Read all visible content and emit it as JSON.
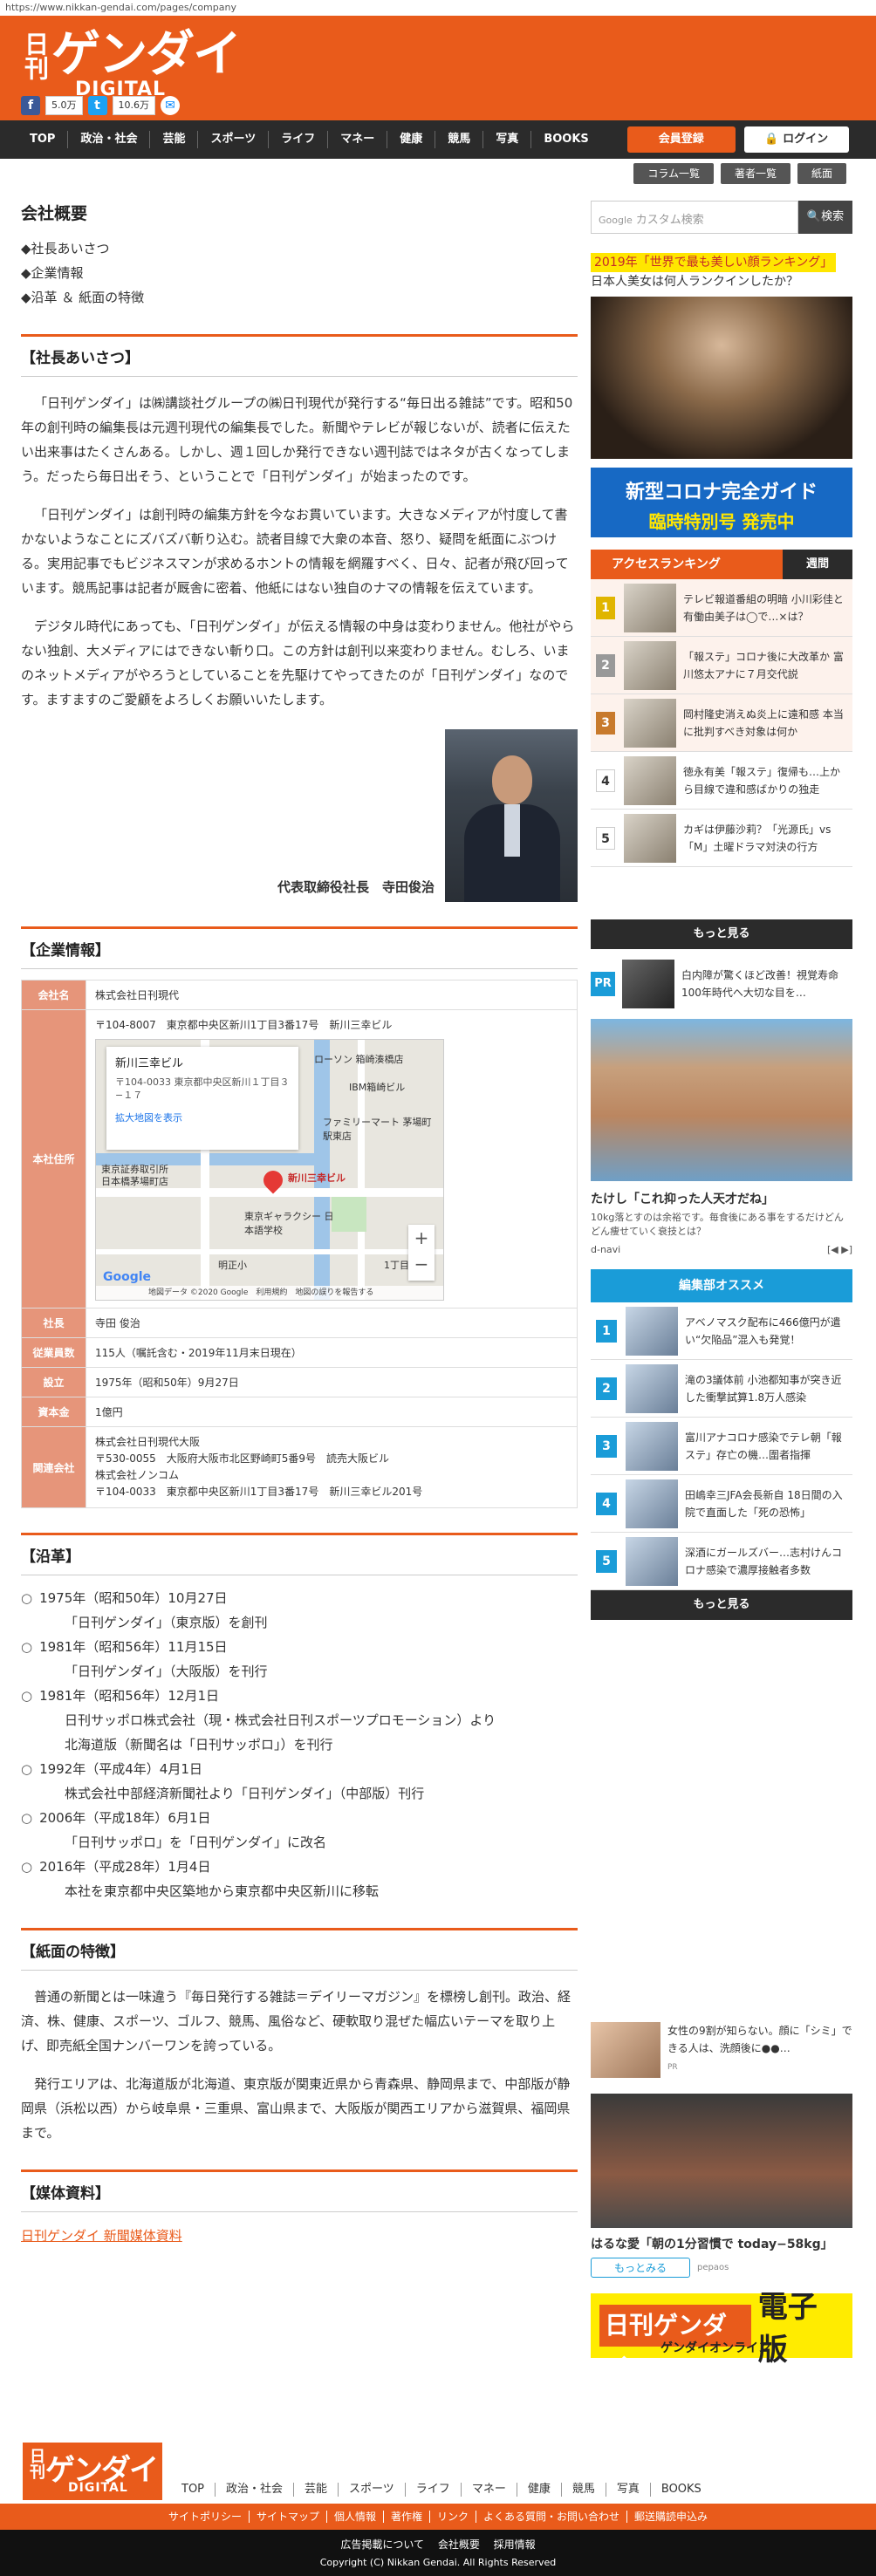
{
  "browser": {
    "url": "https://www.nikkan-gendai.com/pages/company"
  },
  "header": {
    "logo_nikkan": "日刊",
    "logo_gendai": "ゲンダイ",
    "logo_digital": "DIGITAL",
    "fb_count": "5.0万",
    "tw_count": "10.6万"
  },
  "nav": {
    "items": [
      "TOP",
      "政治・社会",
      "芸能",
      "スポーツ",
      "ライフ",
      "マネー",
      "健康",
      "競馬",
      "写真",
      "BOOKS"
    ],
    "member": "会員登録",
    "login": "ログイン"
  },
  "subnav": [
    "コラム一覧",
    "著者一覧",
    "紙面"
  ],
  "page": {
    "title": "会社概要",
    "toc": [
      "◆社長あいさつ",
      "◆企業情報",
      "◆沿革 ＆ 紙面の特徴"
    ]
  },
  "greeting": {
    "heading": "【社長あいさつ】",
    "paragraphs": [
      "「日刊ゲンダイ」は㈱講談社グループの㈱日刊現代が発行する“毎日出る雑誌”です。昭和50年の創刊時の編集長は元週刊現代の編集長でした。新聞やテレビが報じないが、読者に伝えたい出来事はたくさんある。しかし、週１回しか発行できない週刊誌ではネタが古くなってしまう。だったら毎日出そう、ということで「日刊ゲンダイ」が始まったのです。",
      "「日刊ゲンダイ」は創刊時の編集方針を今なお貫いています。大きなメディアが忖度して書かないようなことにズバズバ斬り込む。読者目線で大衆の本音、怒り、疑問を紙面にぶつける。実用記事でもビジネスマンが求めるホントの情報を網羅すべく、日々、記者が飛び回っています。競馬記事は記者が厩舎に密着、他紙にはない独自のナマの情報を伝えています。",
      "デジタル時代にあっても、「日刊ゲンダイ」が伝える情報の中身は変わりません。他社がやらない独創、大メディアにはできない斬り口。この方針は創刊以来変わりません。むしろ、いまのネットメディアがやろうとしていることを先駆けてやってきたのが「日刊ゲンダイ」なのです。ますますのご愛顧をよろしくお願いいたします。"
    ],
    "signature": "代表取締役社長　寺田俊治"
  },
  "company": {
    "heading": "【企業情報】",
    "rows": {
      "name_k": "会社名",
      "name_v": "株式会社日刊現代",
      "addr_k": "本社住所",
      "addr_v": "〒104-8007　東京都中央区新川1丁目3番17号　新川三幸ビル",
      "ceo_k": "社長",
      "ceo_v": "寺田 俊治",
      "emp_k": "従業員数",
      "emp_v": "115人（嘱託含む・2019年11月末日現在）",
      "est_k": "設立",
      "est_v": "1975年（昭和50年）9月27日",
      "cap_k": "資本金",
      "cap_v": "1億円",
      "rel_k": "関連会社",
      "rel_v": [
        "株式会社日刊現代大阪",
        "〒530-0055　大阪府大阪市北区野崎町5番9号　読売大阪ビル",
        "株式会社ノンコム",
        "〒104-0033　東京都中央区新川1丁目3番17号　新川三幸ビル201号"
      ]
    },
    "map": {
      "card_title": "新川三幸ビル",
      "card_addr": "〒104-0033 東京都中央区新川１丁目３−１７",
      "card_link": "拡大地図を表示",
      "labels": [
        "ローソン 箱崎湊橋店",
        "IBM箱崎ビル",
        "ファミリーマート 茅場町駅東店",
        "新川三幸ビル",
        "東京証券取引所",
        "日本橋茅場町店",
        "東京ギャラクシー 日本語学校",
        "明正小",
        "1丁目"
      ],
      "google": "Google",
      "footer": "地図データ ©2020 Google　利用規約　地図の誤りを報告する",
      "zoom_in": "+",
      "zoom_out": "−"
    }
  },
  "history": {
    "heading": "【沿革】",
    "items": [
      {
        "date": "1975年（昭和50年）10月27日",
        "lines": [
          "「日刊ゲンダイ」（東京版）を創刊"
        ]
      },
      {
        "date": "1981年（昭和56年）11月15日",
        "lines": [
          "「日刊ゲンダイ」（大阪版）を刊行"
        ]
      },
      {
        "date": "1981年（昭和56年）12月1日",
        "lines": [
          "日刊サッポロ株式会社（現・株式会社日刊スポーツプロモーション）より",
          "北海道版（新聞名は「日刊サッポロ」）を刊行"
        ]
      },
      {
        "date": "1992年（平成4年）4月1日",
        "lines": [
          "株式会社中部経済新聞社より「日刊ゲンダイ」（中部版）刊行"
        ]
      },
      {
        "date": "2006年（平成18年）6月1日",
        "lines": [
          "「日刊サッポロ」を「日刊ゲンダイ」に改名"
        ]
      },
      {
        "date": "2016年（平成28年）1月4日",
        "lines": [
          "本社を東京都中央区築地から東京都中央区新川に移転"
        ]
      }
    ]
  },
  "feature": {
    "heading": "【紙面の特徴】",
    "paragraphs": [
      "普通の新聞とは一味違う『毎日発行する雑誌＝デイリーマガジン』を標榜し創刊。政治、経済、株、健康、スポーツ、ゴルフ、競馬、風俗など、硬軟取り混ぜた幅広いテーマを取り上げ、即売紙全国ナンバーワンを誇っている。",
      "発行エリアは、北海道版が北海道、東京版が関東近県から青森県、静岡県まで、中部版が静岡県（浜松以西）から岐阜県・三重県、富山県まで、大阪版が関西エリアから滋賀県、福岡県まで。"
    ]
  },
  "media": {
    "heading": "【媒体資料】",
    "link": "日刊ゲンダイ 新聞媒体資料"
  },
  "sidebar": {
    "search_placeholder": "カスタム検索",
    "search_google": "Google",
    "search_btn": "検索",
    "ad1_hl": "2019年「世界で最も美しい顔ランキング」",
    "ad1_sub": "日本人美女は何人ランクインしたか？",
    "ad2_t1": "新型コロナ完全ガイド",
    "ad2_t2": "臨時特別号 発売中",
    "ranking_title": "アクセスランキング",
    "ranking_tab": "週間",
    "ranking": [
      {
        "n": "1",
        "text": "テレビ報道番組の明暗 小川彩佳と有働由美子は◯で…×は？"
      },
      {
        "n": "2",
        "text": "「報ステ」コロナ後に大改革か 富川悠太アナに７月交代説"
      },
      {
        "n": "3",
        "text": "岡村隆史消えぬ炎上に遠和感 本当に批判すべき対象は何か"
      },
      {
        "n": "4",
        "text": "徳永有美「報ステ」復帰も…上から目線で違和感ばかりの独走"
      },
      {
        "n": "5",
        "text": "カギは伊藤沙莉？「光源氏」vs「M」土曜ドラマ対決の行方"
      }
    ],
    "more": "もっと見る",
    "pr_tag": "PR",
    "pr_text": "白内障が驚くほど改善！視覚寿命100年時代へ大切な目を…",
    "ad_body_title": "たけし「これ抑った人天才だね」",
    "ad_body_sub": "10kg落とすのは余裕です。毎食後にある事をするだけどんどん痩せていく衰技とは？",
    "ad_body_src": "d-navi",
    "ad_body_nav": "[◀ ▶]",
    "rec_title": "編集部オススメ",
    "rec": [
      {
        "n": "1",
        "text": "アベノマスク配布に466億円が遣い“欠陥品”混入も発覚！"
      },
      {
        "n": "2",
        "text": "滝の3議体前 小池都知事が突き近した衝撃試算1.8万人感染"
      },
      {
        "n": "3",
        "text": "富川アナコロナ感染でテレ朝「報ステ」存亡の機…圍者指揮"
      },
      {
        "n": "4",
        "text": "田嶋幸三JFA会長新自 18日間の入院で直面した「死の恐怖」"
      },
      {
        "n": "5",
        "text": "深酒にガールズバー…志村けんコロナ感染で濃厚接触者多数"
      }
    ],
    "ad_small_text": "女性の9割が知らない。顔に「シミ」できる人は、洗顔後に●●…",
    "ad_small_pr": "PR",
    "ad_gym_title": "はるな愛「朝の1分習慣で today−58kg」",
    "ad_gym_btn": "もっとみる",
    "ad_gym_src": "pepaos",
    "ebook_logo": "日刊ゲンダイ",
    "ebook_label": "電子版",
    "ebook_sub": "ゲンダイオンライン"
  },
  "footer": {
    "nav": [
      "TOP",
      "政治・社会",
      "芸能",
      "スポーツ",
      "ライフ",
      "マネー",
      "健康",
      "競馬",
      "写真",
      "BOOKS"
    ],
    "links": [
      "サイトポリシー",
      "サイトマップ",
      "個人情報",
      "著作権",
      "リンク",
      "よくある質問・お問い合わせ",
      "郵送購読申込み"
    ],
    "bottom_links": [
      "広告掲載について",
      "会社概要",
      "採用情報"
    ],
    "copyright": "Copyright (C) Nikkan Gendai. All Rights Reserved"
  }
}
